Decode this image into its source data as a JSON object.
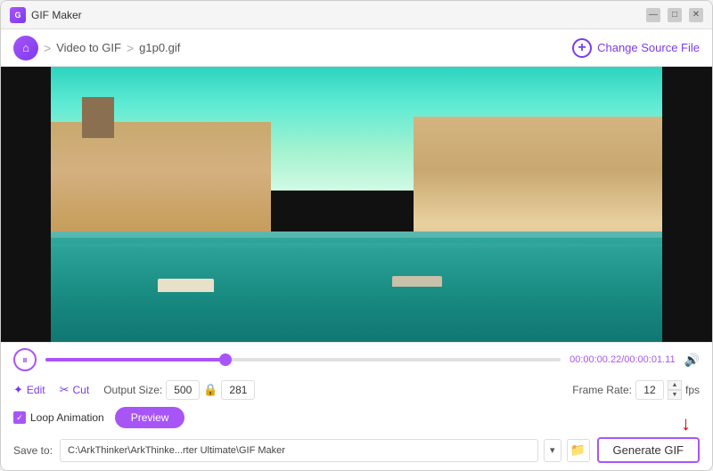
{
  "window": {
    "title": "GIF Maker",
    "min_label": "—",
    "max_label": "□",
    "close_label": "✕"
  },
  "nav": {
    "home_label": "⌂",
    "breadcrumb_sep": ">",
    "breadcrumb_item": "Video to GIF",
    "file_name": "g1p0.gif",
    "change_source_label": "Change Source File",
    "change_source_icon": "+"
  },
  "playback": {
    "pause_icon": "⏸",
    "time_current": "00:00:00.22",
    "time_total": "00:00:01.11",
    "time_separator": "/",
    "volume_icon": "🔊",
    "progress_percent": 35
  },
  "toolbar": {
    "edit_label": "Edit",
    "cut_label": "Cut",
    "output_size_label": "Output Size:",
    "output_width": "500",
    "output_height": "281",
    "frame_rate_label": "Frame Rate:",
    "frame_rate_value": "12",
    "fps_label": "fps"
  },
  "options": {
    "loop_label": "Loop Animation",
    "preview_label": "Preview"
  },
  "save": {
    "save_to_label": "Save to:",
    "save_path": "C:\\ArkThinker\\ArkThinke...rter Ultimate\\GIF Maker",
    "generate_label": "Generate GIF"
  }
}
